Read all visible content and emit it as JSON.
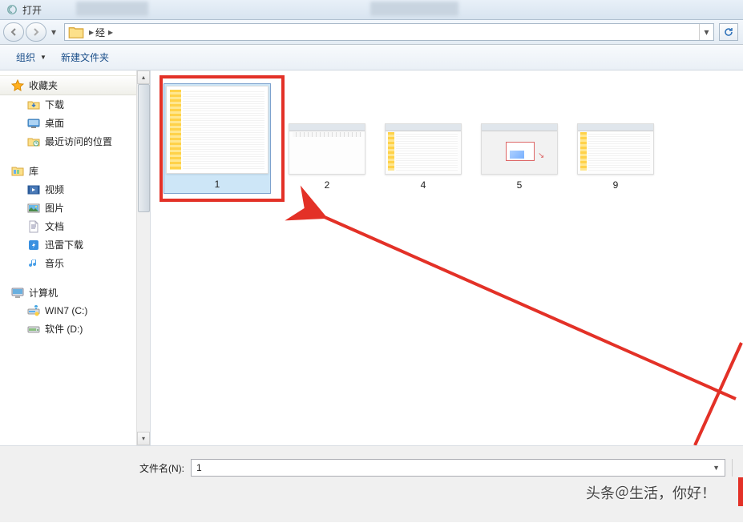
{
  "window": {
    "title": "打开"
  },
  "breadcrumb": {
    "folder": "经"
  },
  "toolbar": {
    "organize": "组织",
    "new_folder": "新建文件夹"
  },
  "sidebar": {
    "favorites": {
      "header": "收藏夹",
      "items": [
        "下载",
        "桌面",
        "最近访问的位置"
      ]
    },
    "libraries": {
      "header": "库",
      "items": [
        "视频",
        "图片",
        "文档",
        "迅雷下载",
        "音乐"
      ]
    },
    "computer": {
      "header": "计算机",
      "items": [
        "WIN7 (C:)",
        "软件 (D:)"
      ]
    }
  },
  "files": [
    {
      "name": "1",
      "selected": true
    },
    {
      "name": "2",
      "selected": false
    },
    {
      "name": "4",
      "selected": false
    },
    {
      "name": "5",
      "selected": false
    },
    {
      "name": "9",
      "selected": false
    }
  ],
  "filename": {
    "label": "文件名(N):",
    "value": "1"
  },
  "watermark": "头条＠生活，你好！",
  "colors": {
    "annotation_red": "#e33127",
    "selection": "#cde6f7"
  }
}
